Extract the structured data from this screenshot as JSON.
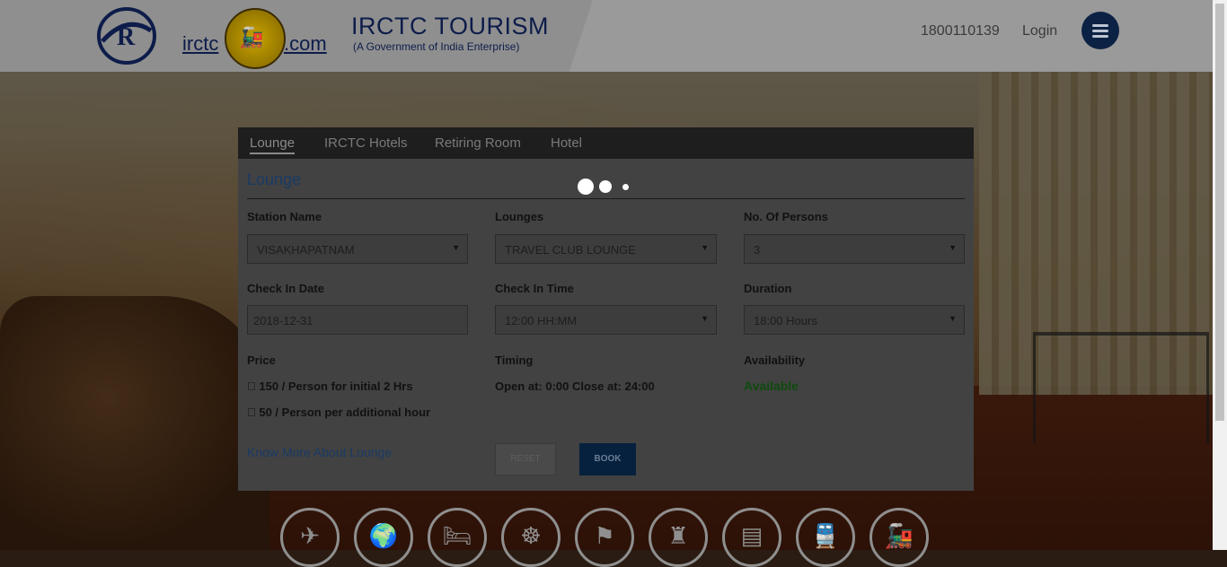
{
  "header": {
    "brand_prefix": "irctc",
    "brand_suffix": ".com",
    "title": "IRCTC TOURISM",
    "subtitle": "(A Government of India Enterprise)",
    "phone": "1800110139",
    "login_label": "Login",
    "menu_icon": "hamburger-icon"
  },
  "tabs": [
    {
      "label": "Lounge",
      "active": true
    },
    {
      "label": "IRCTC Hotels",
      "active": false
    },
    {
      "label": "Retiring Room",
      "active": false
    },
    {
      "label": "Hotel",
      "active": false
    }
  ],
  "form": {
    "heading": "Lounge",
    "station_label": "Station Name",
    "station_value": "VISAKHAPATNAM",
    "lounges_label": "Lounges",
    "lounges_value": "TRAVEL CLUB LOUNGE",
    "persons_label": "No. Of Persons",
    "persons_value": "3",
    "checkin_date_label": "Check In Date",
    "checkin_date_value": "2018-12-31",
    "checkin_time_label": "Check In Time",
    "checkin_time_value": "12:00 HH:MM",
    "duration_label": "Duration",
    "duration_value": "18:00 Hours",
    "price_label": "Price",
    "price_line1": " 150 / Person for initial 2 Hrs",
    "price_line2": " 50 / Person per additional hour",
    "timing_label": "Timing",
    "timing_value": "Open at: 0:00 Close at: 24:00",
    "availability_label": "Availability",
    "availability_value": "Available",
    "know_more": "Know More About Lounge",
    "reset_label": "RESET",
    "book_label": "BOOK"
  },
  "services": [
    {
      "icon": "flight-icon",
      "glyph": "✈"
    },
    {
      "icon": "world-travel-icon",
      "glyph": "🌍"
    },
    {
      "icon": "bed-icon",
      "glyph": "🛏"
    },
    {
      "icon": "buddha-icon",
      "glyph": "☸"
    },
    {
      "icon": "tourist-icon",
      "glyph": "⚑"
    },
    {
      "icon": "heritage-icon",
      "glyph": "♜"
    },
    {
      "icon": "coach-icon",
      "glyph": "▤"
    },
    {
      "icon": "train-icon",
      "glyph": "🚆"
    },
    {
      "icon": "steam-train-icon",
      "glyph": "🚂"
    }
  ],
  "colors": {
    "accent": "#1a3a66",
    "book_button": "#06213e",
    "available": "#0f4a0f"
  }
}
